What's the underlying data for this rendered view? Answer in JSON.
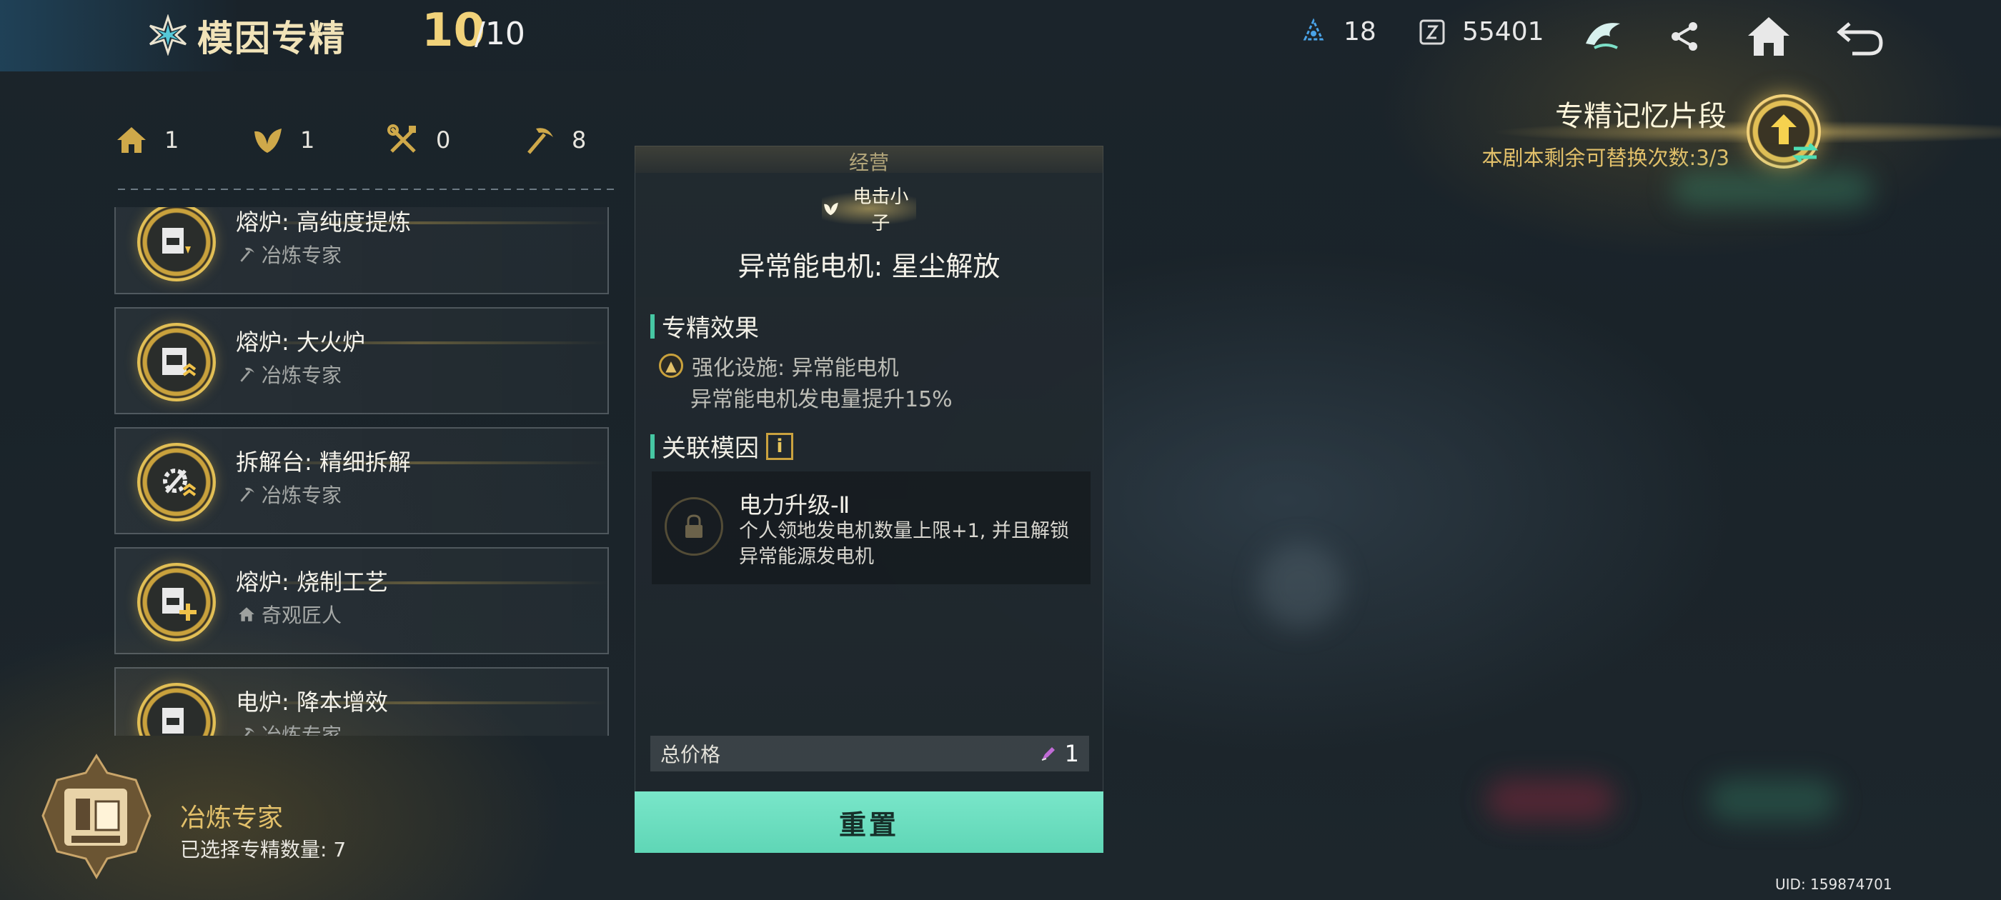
{
  "header": {
    "title": "模因专精",
    "count_current": "10",
    "count_total": "/10",
    "resource_a": "18",
    "resource_b": "55401"
  },
  "stats": [
    {
      "icon": "house-icon",
      "value": "1"
    },
    {
      "icon": "leaf-icon",
      "value": "1"
    },
    {
      "icon": "tools-icon",
      "value": "0"
    },
    {
      "icon": "pickaxe-icon",
      "value": "8"
    }
  ],
  "list": {
    "items": [
      {
        "name": "熔炉: 高纯度提炼",
        "tag": "冶炼专家",
        "tag_icon": "pickaxe-icon"
      },
      {
        "name": "熔炉: 大火炉",
        "tag": "冶炼专家",
        "tag_icon": "pickaxe-icon"
      },
      {
        "name": "拆解台: 精细拆解",
        "tag": "冶炼专家",
        "tag_icon": "pickaxe-icon"
      },
      {
        "name": "熔炉: 烧制工艺",
        "tag": "奇观匠人",
        "tag_icon": "house-icon"
      },
      {
        "name": "电炉: 降本增效",
        "tag": "冶炼专家",
        "tag_icon": "pickaxe-icon"
      }
    ]
  },
  "specialty": {
    "name": "冶炼专家",
    "selected": "已选择专精数量: 7"
  },
  "detail": {
    "category": "经营",
    "tag": "电击小子",
    "title": "异常能电机: 星尘解放",
    "effect_heading": "专精效果",
    "effect_line1": "强化设施: 异常能电机",
    "effect_line2": "异常能电机发电量提升15%",
    "related_heading": "关联模因",
    "gene_name": "电力升级-Ⅱ",
    "gene_desc": "个人领地发电机数量上限+1, 并且解锁异常能源发电机",
    "price_label": "总价格",
    "price_value": "1",
    "reset_label": "重置"
  },
  "memory": {
    "title": "专精记忆片段",
    "subtitle": "本剧本剩余可替换次数:3/3"
  },
  "uid": "UID: 159874701",
  "colors": {
    "gold": "#e2c06a",
    "teal": "#5fd6b6",
    "accent_bar": "#46c7a3"
  }
}
